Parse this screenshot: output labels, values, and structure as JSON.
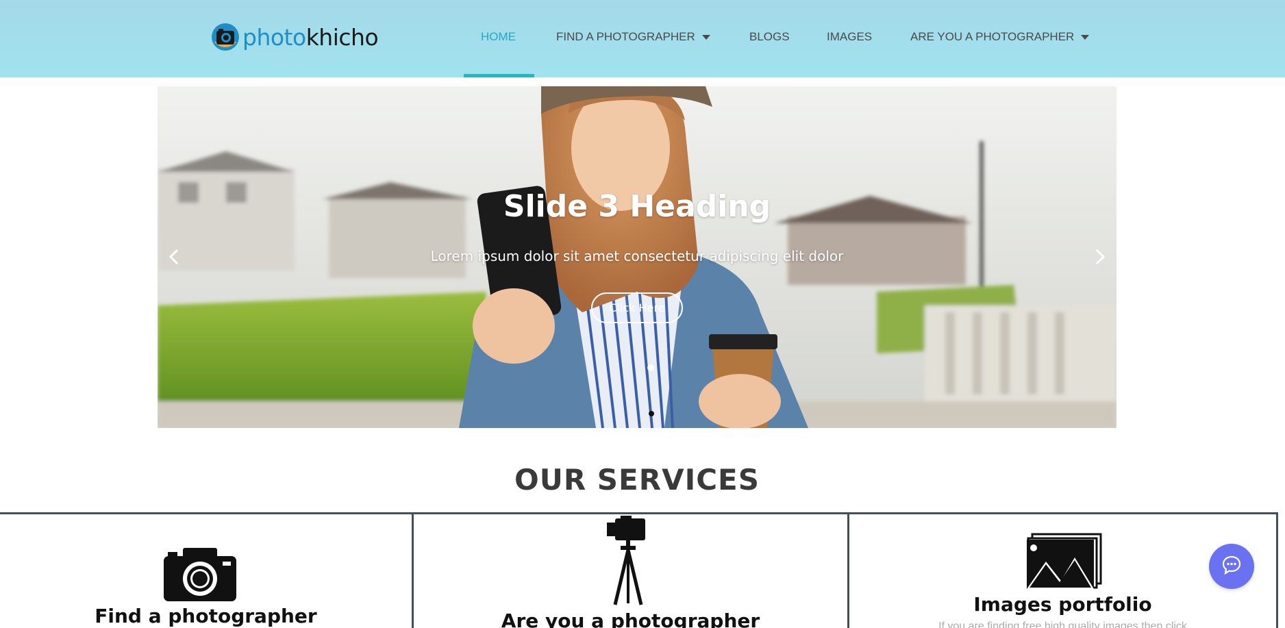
{
  "header": {
    "logo": {
      "part1": "photo",
      "part2": "khicho"
    },
    "nav": [
      {
        "label": "HOME",
        "active": true,
        "dropdown": false
      },
      {
        "label": "FIND A PHOTOGRAPHER",
        "active": false,
        "dropdown": true
      },
      {
        "label": "BLOGS",
        "active": false,
        "dropdown": false
      },
      {
        "label": "IMAGES",
        "active": false,
        "dropdown": false
      },
      {
        "label": "ARE YOU A PHOTOGRAPHER",
        "active": false,
        "dropdown": true
      }
    ]
  },
  "slider": {
    "heading": "Slide 3 Heading",
    "text": "Lorem ipsum dolor sit amet consectetur adipiscing elit dolor",
    "button": "Click Here",
    "icons": {
      "prev": "chevron-left-icon",
      "next": "chevron-right-icon"
    }
  },
  "services": {
    "title": "OUR SERVICES",
    "items": [
      {
        "title": "Find a photographer",
        "icon": "camera-icon",
        "description": ""
      },
      {
        "title": "Are you a photographer",
        "icon": "tripod-camera-icon",
        "description": ""
      },
      {
        "title": "Images portfolio",
        "icon": "image-gallery-icon",
        "description": "If you are finding free high quality images then click"
      }
    ]
  },
  "chat": {
    "icon": "chat-icon"
  },
  "colors": {
    "header_bg": "#a5d8e8",
    "accent": "#25a9c4",
    "logo_blue": "#1e8fc6",
    "chat_bg": "#6b72f2",
    "border": "#444e5a"
  }
}
